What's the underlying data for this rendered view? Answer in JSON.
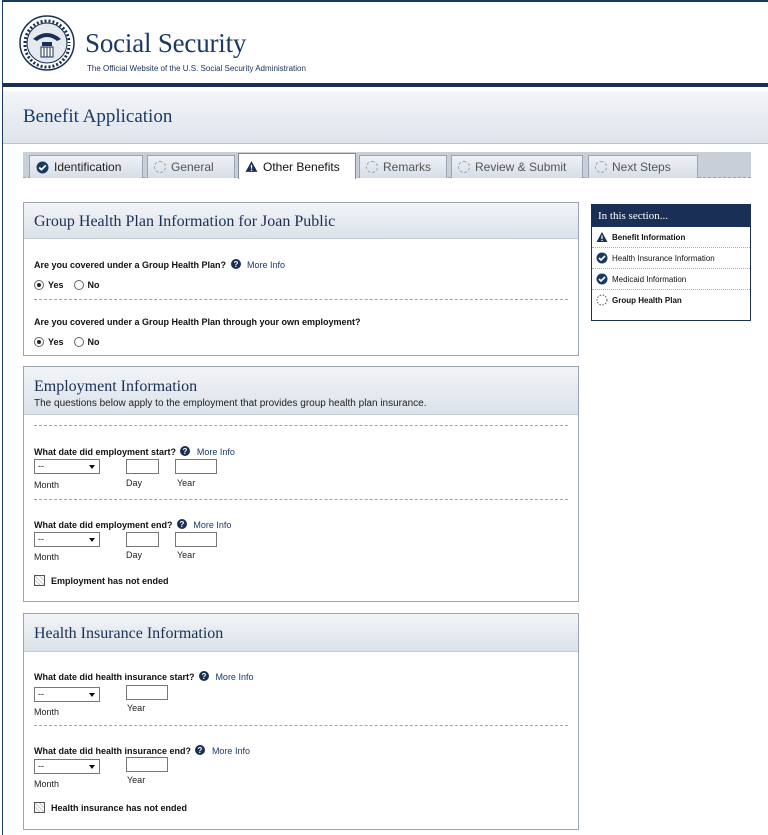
{
  "header": {
    "title": "Social Security",
    "subtitle": "The Official Website of the U.S. Social Security Administration"
  },
  "page": {
    "title": "Benefit Application"
  },
  "tabs": [
    {
      "label": "Identification",
      "state": "done",
      "icon": "check-circle-icon"
    },
    {
      "label": "General",
      "state": "pending",
      "icon": "dashed-circle-icon"
    },
    {
      "label": "Other Benefits",
      "state": "active",
      "icon": "warning-icon"
    },
    {
      "label": "Remarks",
      "state": "pending",
      "icon": "dashed-circle-icon"
    },
    {
      "label": "Review & Submit",
      "state": "pending",
      "icon": "dashed-circle-icon"
    },
    {
      "label": "Next Steps",
      "state": "pending",
      "icon": "dashed-circle-icon"
    }
  ],
  "group_health": {
    "title": "Group Health Plan Information for Joan Public",
    "q1": {
      "label": "Are you covered under a Group Health Plan?",
      "more_info": "More Info",
      "yes": "Yes",
      "no": "No",
      "selected": "Yes"
    },
    "q2": {
      "label": "Are you covered under a Group Health Plan through your own employment?",
      "yes": "Yes",
      "no": "No",
      "selected": "Yes"
    }
  },
  "employment": {
    "title": "Employment Information",
    "description": "The questions below apply to the employment that provides group health plan insurance.",
    "start": {
      "label": "What date did employment start?",
      "more_info": "More Info",
      "month_value": "--",
      "month_label": "Month",
      "day_label": "Day",
      "year_label": "Year"
    },
    "end": {
      "label": "What date did employment end?",
      "more_info": "More Info",
      "month_value": "--",
      "month_label": "Month",
      "day_label": "Day",
      "year_label": "Year"
    },
    "not_ended": "Employment has not ended"
  },
  "health_insurance": {
    "title": "Health Insurance Information",
    "start": {
      "label": "What date did health insurance start?",
      "more_info": "More Info",
      "month_value": "--",
      "month_label": "Month",
      "year_label": "Year"
    },
    "end": {
      "label": "What date did health insurance end?",
      "more_info": "More Info",
      "month_value": "--",
      "month_label": "Month",
      "year_label": "Year"
    },
    "not_ended": "Health insurance has not ended"
  },
  "side_nav": {
    "title": "In this section...",
    "items": [
      {
        "label": "Benefit Information",
        "icon": "warning-icon"
      },
      {
        "label": "Health Insurance Information",
        "icon": "check-circle-icon"
      },
      {
        "label": "Medicaid Information",
        "icon": "check-circle-icon"
      },
      {
        "label": "Group Health Plan",
        "icon": "dashed-circle-icon"
      }
    ]
  },
  "colors": {
    "brand_navy": "#1a2f55",
    "accent_blue": "#1a3a66",
    "panel_border": "#9aa4b2"
  }
}
